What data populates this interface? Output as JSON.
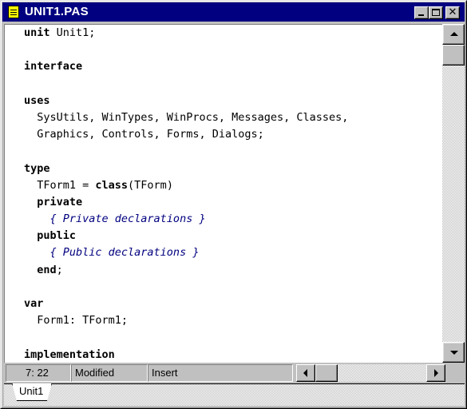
{
  "window": {
    "title": "UNIT1.PAS",
    "icon": "document-icon",
    "controls": [
      "minimize-icon",
      "maximize-icon",
      "close-icon"
    ],
    "close_glyph": "✕"
  },
  "editor": {
    "lines": [
      [
        {
          "t": "unit",
          "s": "kw"
        },
        {
          "t": " Unit1;"
        }
      ],
      [],
      [
        {
          "t": "interface",
          "s": "kw"
        }
      ],
      [],
      [
        {
          "t": "uses",
          "s": "kw"
        }
      ],
      [
        {
          "t": "  SysUtils, WinTypes, WinProcs, Messages, Classes,"
        }
      ],
      [
        {
          "t": "  Graphics, Controls, Forms, Dialogs;"
        }
      ],
      [],
      [
        {
          "t": "type",
          "s": "kw"
        }
      ],
      [
        {
          "t": "  TForm1 = "
        },
        {
          "t": "class",
          "s": "kw"
        },
        {
          "t": "(TForm)"
        }
      ],
      [
        {
          "t": "  "
        },
        {
          "t": "private",
          "s": "kw"
        }
      ],
      [
        {
          "t": "    { Private declarations }",
          "s": "comment"
        }
      ],
      [
        {
          "t": "  "
        },
        {
          "t": "public",
          "s": "kw"
        }
      ],
      [
        {
          "t": "    { Public declarations }",
          "s": "comment"
        }
      ],
      [
        {
          "t": "  "
        },
        {
          "t": "end",
          "s": "kw"
        },
        {
          "t": ";"
        }
      ],
      [],
      [
        {
          "t": "var",
          "s": "kw"
        }
      ],
      [
        {
          "t": "  Form1: TForm1;"
        }
      ],
      [],
      [
        {
          "t": "implementation",
          "s": "kw"
        }
      ]
    ]
  },
  "status": {
    "position": "7: 22",
    "modified": "Modified",
    "mode": "Insert"
  },
  "tabs": [
    {
      "label": "Unit1",
      "active": true
    }
  ],
  "colors": {
    "titlebar": "#000080",
    "comment": "#000080",
    "face": "#c0c0c0"
  }
}
